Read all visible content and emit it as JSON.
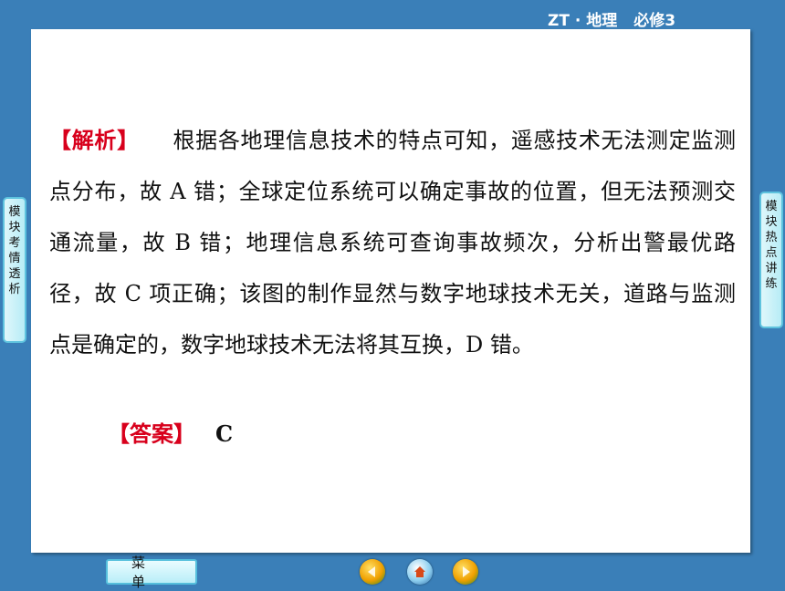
{
  "header": {
    "course": "ZT · 地理",
    "book": "必修3"
  },
  "content": {
    "analysis_tag": "【解析】",
    "analysis_text": "根据各地理信息技术的特点可知，遥感技术无法测定监测点分布，故 A 错；全球定位系统可以确定事故的位置，但无法预测交通流量，故 B 错；地理信息系统可查询事故频次，分析出警最优路径，故 C 项正确；该图的制作显然与数字地球技术无关，道路与监测点是确定的，数字地球技术无法将其互换，D 错。",
    "answer_tag": "【答案】",
    "answer_value": "C"
  },
  "side_tabs": {
    "left": "模块考情透析",
    "right": "模块热点讲练"
  },
  "footer": {
    "menu_label": "菜单",
    "nav_icons": [
      "previous-icon",
      "home-icon",
      "next-icon"
    ]
  },
  "colors": {
    "background": "#3a7fb8",
    "tag_red": "#d8001c",
    "tab_border": "#5ec3de"
  }
}
